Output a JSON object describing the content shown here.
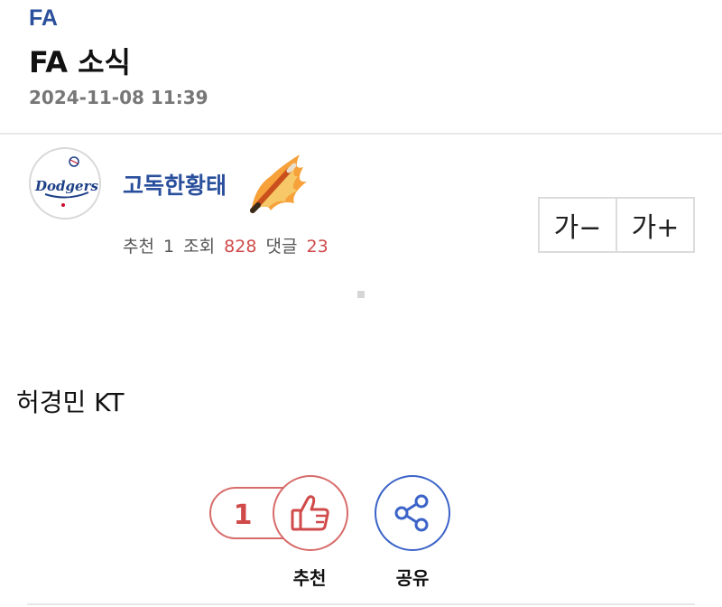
{
  "post": {
    "category": "FA",
    "title": "FA 소식",
    "date": "2024-11-08 11:39",
    "body": "허경민 KT"
  },
  "author": {
    "name": "고독한황태",
    "avatar_icon": "dodgers-logo-icon",
    "avatar_text": "Dodgers",
    "badge_icon": "flaming-pen-icon"
  },
  "stats": {
    "recommend_label": "추천",
    "recommend_count": "1",
    "views_label": "조회",
    "views_count": "828",
    "comments_label": "댓글",
    "comments_count": "23"
  },
  "font_controls": {
    "decrease": "가−",
    "increase": "가+"
  },
  "actions": {
    "like_count": "1",
    "like_icon": "thumbs-up-icon",
    "like_label": "추천",
    "share_icon": "share-icon",
    "share_label": "공유"
  },
  "colors": {
    "accent_blue": "#2a4f9c",
    "count_red": "#d04a4a",
    "like_border": "#d86b6b",
    "share_blue": "#3b63c8"
  }
}
